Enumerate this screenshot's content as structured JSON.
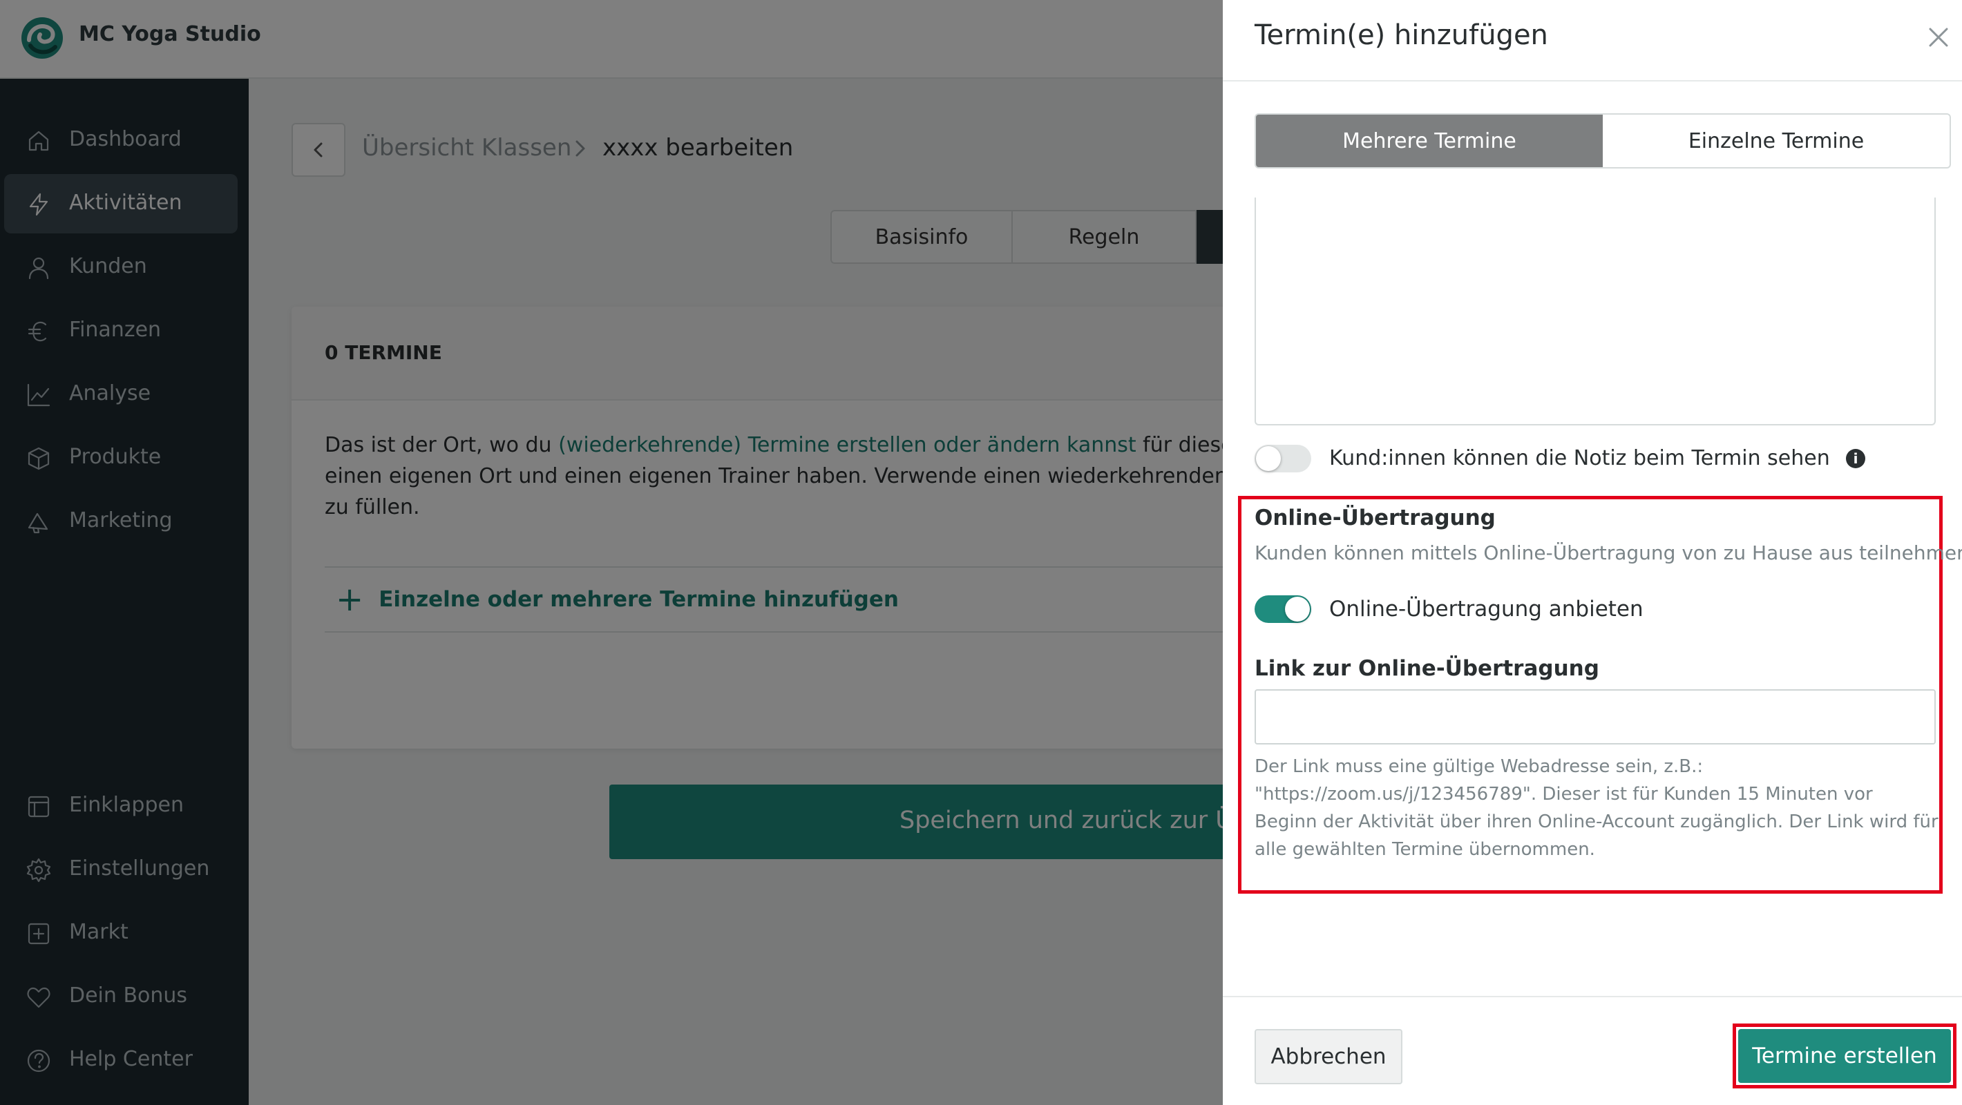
{
  "app": {
    "name": "MC Yoga Studio"
  },
  "sidebar": {
    "items": [
      {
        "label": "Dashboard",
        "icon": "home-icon",
        "active": false
      },
      {
        "label": "Aktivitäten",
        "icon": "lightning-icon",
        "active": true
      },
      {
        "label": "Kunden",
        "icon": "user-icon",
        "active": false
      },
      {
        "label": "Finanzen",
        "icon": "euro-icon",
        "active": false
      },
      {
        "label": "Analyse",
        "icon": "chart-line-icon",
        "active": false
      },
      {
        "label": "Produkte",
        "icon": "box-icon",
        "active": false
      },
      {
        "label": "Marketing",
        "icon": "megaphone-icon",
        "active": false
      }
    ],
    "bottom_items": [
      {
        "label": "Einklappen",
        "icon": "collapse-icon"
      },
      {
        "label": "Einstellungen",
        "icon": "gear-icon"
      },
      {
        "label": "Markt",
        "icon": "plus-square-icon"
      },
      {
        "label": "Dein Bonus",
        "icon": "heart-icon"
      },
      {
        "label": "Help Center",
        "icon": "help-icon"
      }
    ]
  },
  "breadcrumb": {
    "parent": "Übersicht Klassen",
    "current": "xxxx bearbeiten"
  },
  "tabs": [
    "Basisinfo",
    "Regeln"
  ],
  "card": {
    "count_label": "0 TERMINE",
    "text_before_link": "Das ist der Ort, wo du ",
    "link_text": "(wiederkehrende) Termine erstellen oder ändern kannst",
    "text_after_link": " für diese Ak",
    "line2": "einen eigenen Ort und einen eigenen Trainer haben. Verwende einen wiederkehrenden Ter",
    "line3": "zu füllen.",
    "add_label": "Einzelne oder mehrere Termine hinzufügen"
  },
  "save_button": {
    "label": "Speichern und zurück zur Üb"
  },
  "drawer": {
    "title": "Termin(e) hinzufügen",
    "segments": [
      "Mehrere Termine",
      "Einzelne Termine"
    ],
    "selected_segment": 0,
    "note_visibility": {
      "label": "Kund:innen können die Notiz beim Termin sehen",
      "on": false
    },
    "online": {
      "title": "Online-Übertragung",
      "description": "Kunden können mittels Online-Übertragung von zu Hause aus teilnehmen.",
      "toggle_label": "Online-Übertragung anbieten",
      "toggle_on": true,
      "link_label": "Link zur Online-Übertragung",
      "link_value": "",
      "help_text": "Der Link muss eine gültige Webadresse sein, z.B.: \"https://zoom.us/j/123456789\". Dieser ist für Kunden 15 Minuten vor Beginn der Aktivität über ihren Online-Account zugänglich. Der Link wird für alle gewählten Termine übernommen."
    },
    "cancel_label": "Abbrechen",
    "create_label": "Termine erstellen"
  },
  "colors": {
    "accent": "#1f8c7e",
    "sidebar": "#1f2a30",
    "highlight": "#e3001b"
  }
}
